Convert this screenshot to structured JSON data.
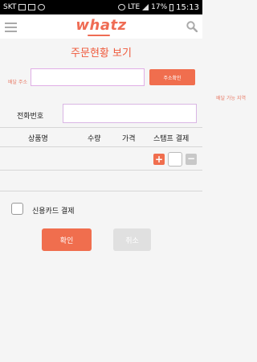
{
  "status_bar": {
    "carrier": "SKT",
    "network": "LTE",
    "battery": "17%",
    "time": "15:13"
  },
  "app": {
    "logo": "whatz",
    "menu_icon": "hamburger-menu-icon",
    "search_icon": "search-icon"
  },
  "page": {
    "title": "주문현황 보기"
  },
  "address": {
    "label": "배달 주소",
    "value": "",
    "find_button": "주소확인",
    "area_link": "배달 가능 지역"
  },
  "phone": {
    "label": "전화번호",
    "value": ""
  },
  "table": {
    "headers": [
      "상품명",
      "수량",
      "가격",
      "스탬프 결제"
    ]
  },
  "stamp": {
    "plus": "+",
    "minus": "−"
  },
  "payment": {
    "credit_card_label": "신용카드 결제",
    "checked": false
  },
  "actions": {
    "confirm": "확인",
    "cancel": "취소"
  },
  "colors": {
    "accent": "#f06e4e",
    "title": "#ef5a3c",
    "disabled": "#e0e0e0"
  }
}
